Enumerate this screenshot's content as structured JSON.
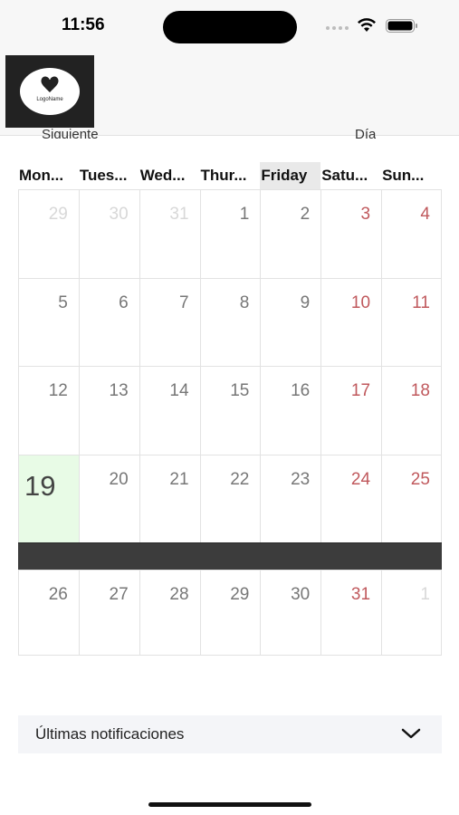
{
  "status_bar": {
    "time": "11:56"
  },
  "header": {
    "logo_text": "LogoName",
    "nav_left": "Siguiente",
    "nav_right": "Día"
  },
  "calendar": {
    "weekdays": [
      "Mon...",
      "Tues...",
      "Wed...",
      "Thur...",
      "Friday",
      "Satu...",
      "Sun..."
    ],
    "weeks": [
      [
        "29",
        "30",
        "31",
        "1",
        "2",
        "3",
        "4"
      ],
      [
        "5",
        "6",
        "7",
        "8",
        "9",
        "10",
        "11"
      ],
      [
        "12",
        "13",
        "14",
        "15",
        "16",
        "17",
        "18"
      ],
      [
        "19",
        "20",
        "21",
        "22",
        "23",
        "24",
        "25"
      ],
      [
        "26",
        "27",
        "28",
        "29",
        "30",
        "31",
        "1"
      ]
    ],
    "today": "19"
  },
  "notifications": {
    "label": "Últimas notificaciones"
  },
  "colors": {
    "weekend": "#c0595d",
    "today_bg": "#e8fbe6",
    "band": "#3c3c3c"
  }
}
